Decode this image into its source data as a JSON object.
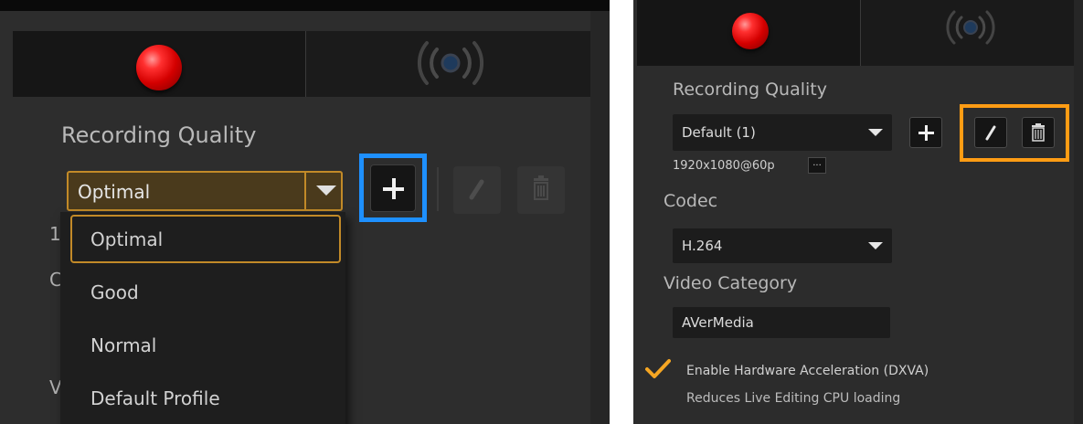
{
  "left_panel": {
    "tabs": {
      "record_icon": "record-dot-icon",
      "live_icon": "broadcast-icon"
    },
    "recording_quality_label": "Recording Quality",
    "quality_select": {
      "value": "Optimal"
    },
    "dropdown_options": [
      "Optimal",
      "Good",
      "Normal",
      "Default Profile"
    ],
    "selected_option": "Optimal",
    "accent_color": "#c28a28",
    "highlight_color": "#1e90ff",
    "hidden_label_initials": [
      "1",
      "C",
      "V"
    ]
  },
  "right_panel": {
    "tabs": {
      "record_icon": "record-dot-icon",
      "live_icon": "broadcast-icon"
    },
    "recording_quality_label": "Recording Quality",
    "quality_select": {
      "value": "Default (1)"
    },
    "resolution": "1920x1080@60p",
    "more_button": "...",
    "codec_label": "Codec",
    "codec_select": {
      "value": "H.264"
    },
    "video_category_label": "Video Category",
    "video_category_value": "AVerMedia",
    "hw_accel": {
      "checked": true,
      "label": "Enable Hardware Acceleration (DXVA)",
      "description": "Reduces Live Editing CPU loading"
    },
    "highlight_color": "#ff9c14"
  }
}
